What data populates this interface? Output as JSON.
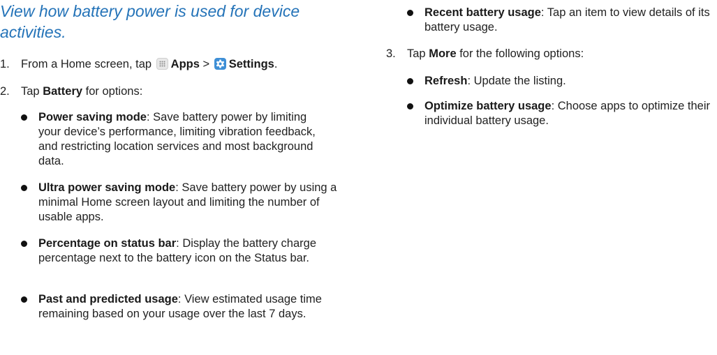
{
  "heading": "View how battery power is used for device activities.",
  "step1": {
    "number": "1.",
    "prefix": "From a Home screen, tap",
    "apps_label": "Apps",
    "separator": ">",
    "settings_label": "Settings",
    "suffix": "."
  },
  "step2": {
    "number": "2.",
    "prefix": "Tap",
    "battery_label": "Battery",
    "suffix": "for options:"
  },
  "battery_options": [
    {
      "term": "Power saving mode",
      "desc": ": Save battery power by limiting your device’s performance, limiting vibration feedback, and restricting location services and most background data."
    },
    {
      "term": "Ultra power saving mode",
      "desc": ": Save battery power by using a minimal Home screen layout and limiting the number of usable apps."
    },
    {
      "term": "Percentage on status bar",
      "desc": ": Display the battery charge percentage next to the battery icon on the Status bar."
    },
    {
      "term": "Past and predicted usage",
      "desc": ": View estimated usage time remaining based on your usage over the last 7 days."
    },
    {
      "term": "Recent battery usage",
      "desc": ": Tap an item to view details of its battery usage."
    }
  ],
  "step3": {
    "number": "3.",
    "prefix": "Tap",
    "more_label": "More",
    "suffix": "for the following options:"
  },
  "more_options": [
    {
      "term": "Refresh",
      "desc": ": Update the listing."
    },
    {
      "term": "Optimize battery usage",
      "desc": ": Choose apps to optimize their individual battery usage."
    }
  ],
  "icons": {
    "apps": "apps-grid-icon",
    "settings": "settings-gear-icon"
  },
  "colors": {
    "heading": "#2473b8",
    "settings_icon": "#3e8fd6"
  }
}
